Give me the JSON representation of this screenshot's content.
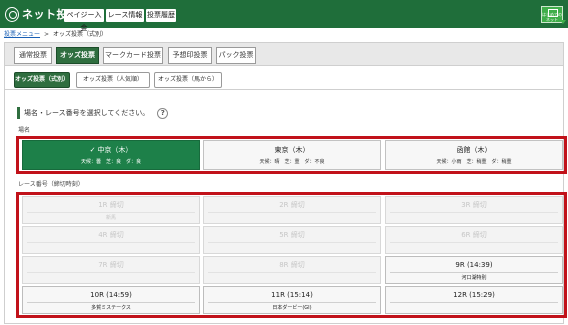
{
  "header": {
    "logo_text": "ネット投票",
    "buttons": [
      "ペイジー入金",
      "レース情報",
      "投票履歴"
    ],
    "guide_label": "はじめてのネット",
    "brand_color": "#1f6e3a"
  },
  "breadcrumb": {
    "link": "投票メニュー",
    "separator": ">",
    "current": "オッズ投票（式別）"
  },
  "tabs": [
    {
      "label": "通常投票",
      "active": false
    },
    {
      "label": "オッズ投票",
      "active": true
    },
    {
      "label": "マークカード投票",
      "active": false
    },
    {
      "label": "予想印投票",
      "active": false
    },
    {
      "label": "パック投票",
      "active": false
    }
  ],
  "subtabs": [
    {
      "label": "オッズ投票（式別）",
      "active": true
    },
    {
      "label": "オッズ投票（人気順）",
      "active": false
    },
    {
      "label": "オッズ投票（馬から）",
      "active": false
    }
  ],
  "instruction": {
    "text": "場名・レース番号を選択してください。",
    "help_icon": "help-icon",
    "help_glyph": "?"
  },
  "venue_section": {
    "label": "場名",
    "venues": [
      {
        "name": "中京（木）",
        "selected": true,
        "condition": "天候：曇　芝：良　ダ：良"
      },
      {
        "name": "東京（木）",
        "selected": false,
        "condition": "天候：晴　芝：重　ダ：不良"
      },
      {
        "name": "函館（木）",
        "selected": false,
        "condition": "天候：小雨　芝：稍重　ダ：稍重"
      }
    ],
    "check_mark": "✓"
  },
  "race_section": {
    "label": "レース番号（締切時刻）",
    "races": [
      {
        "time": "1R 締切",
        "name": "新馬",
        "open": false
      },
      {
        "time": "2R 締切",
        "name": "",
        "open": false
      },
      {
        "time": "3R 締切",
        "name": "",
        "open": false
      },
      {
        "time": "4R 締切",
        "name": "",
        "open": false
      },
      {
        "time": "5R 締切",
        "name": "",
        "open": false
      },
      {
        "time": "6R 締切",
        "name": "",
        "open": false
      },
      {
        "time": "7R 締切",
        "name": "",
        "open": false
      },
      {
        "time": "8R 締切",
        "name": "",
        "open": false
      },
      {
        "time": "9R (14:39)",
        "name": "河口湖特別",
        "open": true
      },
      {
        "time": "10R (14:59)",
        "name": "多賀ミステークス",
        "open": true
      },
      {
        "time": "11R (15:14)",
        "name": "日本ダービー(GI)",
        "open": true
      },
      {
        "time": "12R (15:29)",
        "name": "",
        "open": true
      }
    ]
  },
  "colors": {
    "active_tab": "#2f6e3f",
    "selected_venue": "#1d8049",
    "highlight_border": "#c1121a",
    "link": "#1a5fb4"
  }
}
